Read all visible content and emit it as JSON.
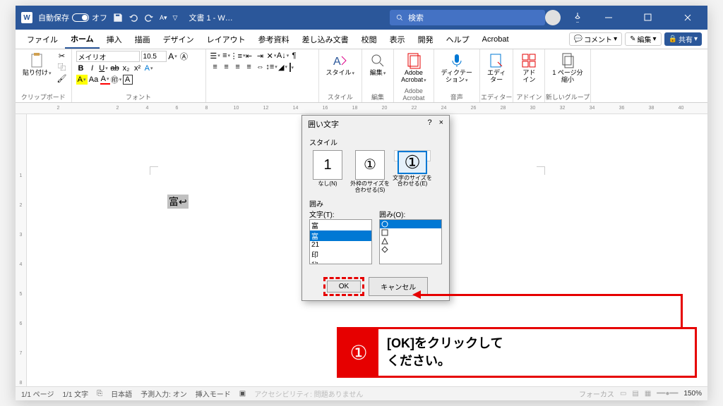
{
  "titlebar": {
    "autosave_label": "自動保存",
    "autosave_state": "オフ",
    "doc_title": "文書 1 - W…",
    "search_placeholder": "検索"
  },
  "tabs": {
    "items": [
      "ファイル",
      "ホーム",
      "挿入",
      "描画",
      "デザイン",
      "レイアウト",
      "参考資料",
      "差し込み文書",
      "校閲",
      "表示",
      "開発",
      "ヘルプ",
      "Acrobat"
    ],
    "active": 1,
    "comment": "コメント",
    "edit": "編集",
    "share": "共有"
  },
  "ribbon": {
    "clipboard": {
      "paste": "貼り付け",
      "label": "クリップボード"
    },
    "font": {
      "name": "メイリオ",
      "size": "10.5",
      "label": "フォント"
    },
    "styles": {
      "btn": "スタイル",
      "label": "スタイル"
    },
    "editing": {
      "btn": "編集",
      "label": "編集"
    },
    "acrobat": {
      "btn": "Adobe\nAcrobat",
      "label": "Adobe Acrobat"
    },
    "dictate": {
      "btn": "ディクテー\nション",
      "label": "音声"
    },
    "editor": {
      "btn": "エディ\nター",
      "label": "エディター"
    },
    "addin": {
      "btn": "アド\nイン",
      "label": "アドイン"
    },
    "newgroup": {
      "btn": "1 ページ分\n縮小",
      "label": "新しいグループ"
    }
  },
  "document": {
    "selected_text": "富↩"
  },
  "dialog": {
    "title": "囲い文字",
    "help": "?",
    "close": "×",
    "style_label": "スタイル",
    "styles": [
      {
        "glyph": "1",
        "label": "なし(N)"
      },
      {
        "glyph": "①",
        "label": "外枠のサイズを\n合わせる(S)"
      },
      {
        "glyph": "①",
        "label": "文字のサイズを\n合わせる(E)",
        "selected": true
      }
    ],
    "enclose_label": "囲み",
    "char_label": "文字(T):",
    "shape_label": "囲み(O):",
    "chars": [
      "富",
      "富",
      "21",
      "印",
      "秘"
    ],
    "char_selected": 1,
    "shapes": [
      "○",
      "□",
      "△",
      "◇"
    ],
    "shape_selected": 0,
    "ok": "OK",
    "cancel": "キャンセル"
  },
  "callout": {
    "num": "①",
    "line1": "[OK]をクリックして",
    "line2": "ください。"
  },
  "statusbar": {
    "page": "1/1 ページ",
    "words": "1/1 文字",
    "lang": "日本語",
    "predict": "予測入力: オン",
    "insert": "挿入モード",
    "access": "アクセシビリティ: 問題ありません",
    "focus": "フォーカス",
    "zoom": "150%"
  }
}
